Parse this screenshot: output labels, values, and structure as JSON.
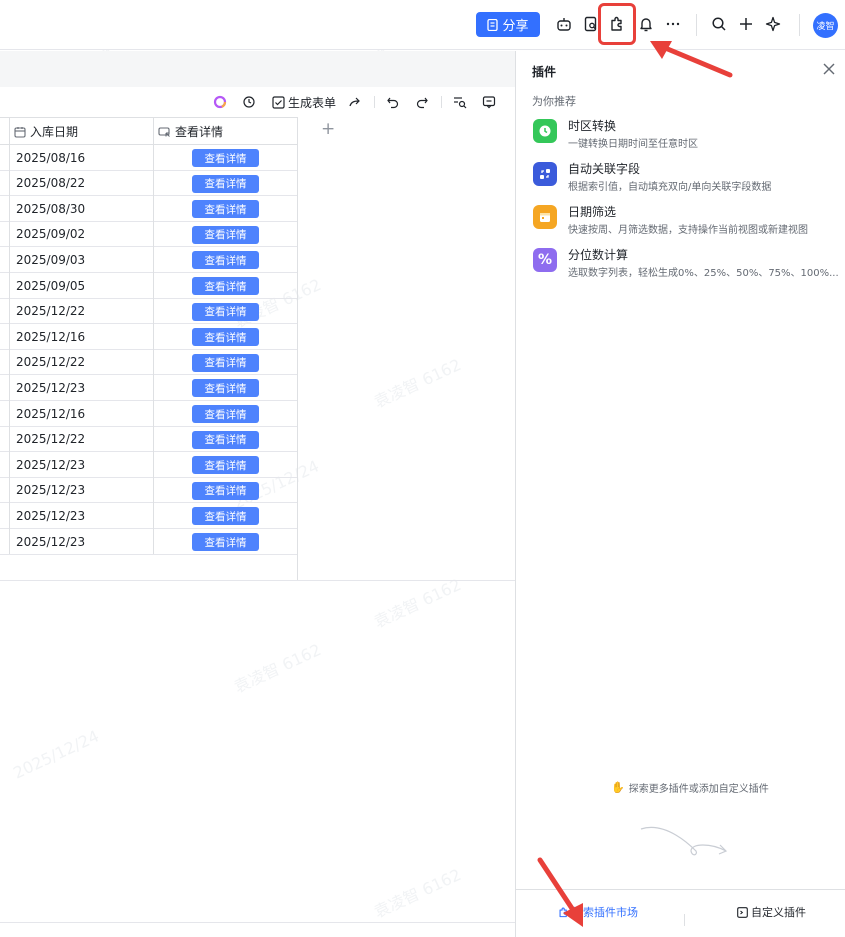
{
  "header": {
    "share_label": "分享",
    "avatar_label": "凌智"
  },
  "toolbar": {
    "generate_form_label": "生成表单"
  },
  "table": {
    "columns": [
      {
        "label": "入库日期",
        "icon": "calendar-icon"
      },
      {
        "label": "查看详情",
        "icon": "button-field-icon"
      }
    ],
    "add_column_label": "+",
    "rows": [
      {
        "date": "2025/08/16",
        "button": "查看详情"
      },
      {
        "date": "2025/08/22",
        "button": "查看详情"
      },
      {
        "date": "2025/08/30",
        "button": "查看详情"
      },
      {
        "date": "2025/09/02",
        "button": "查看详情"
      },
      {
        "date": "2025/09/03",
        "button": "查看详情"
      },
      {
        "date": "2025/09/05",
        "button": "查看详情"
      },
      {
        "date": "2025/12/22",
        "button": "查看详情"
      },
      {
        "date": "2025/12/16",
        "button": "查看详情"
      },
      {
        "date": "2025/12/22",
        "button": "查看详情"
      },
      {
        "date": "2025/12/23",
        "button": "查看详情"
      },
      {
        "date": "2025/12/16",
        "button": "查看详情"
      },
      {
        "date": "2025/12/22",
        "button": "查看详情"
      },
      {
        "date": "2025/12/23",
        "button": "查看详情"
      },
      {
        "date": "2025/12/23",
        "button": "查看详情"
      },
      {
        "date": "2025/12/23",
        "button": "查看详情"
      },
      {
        "date": "2025/12/23",
        "button": "查看详情"
      }
    ]
  },
  "panel": {
    "title": "插件",
    "recommend_label": "为你推荐",
    "plugins": [
      {
        "name": "时区转换",
        "desc": "一键转换日期时间至任意时区",
        "color": "#34c759",
        "icon": "clock-icon"
      },
      {
        "name": "自动关联字段",
        "desc": "根据索引值，自动填充双向/单向关联字段数据",
        "color": "#3b5bdb",
        "icon": "link-field-icon"
      },
      {
        "name": "日期筛选",
        "desc": "快速按周、月筛选数据，支持操作当前视图或新建视图",
        "color": "#f5a623",
        "icon": "calendar-icon"
      },
      {
        "name": "分位数计算",
        "desc": "选取数字列表，轻松生成0%、25%、50%、75%、100%...",
        "color": "#8e6cef",
        "icon": "percent-icon"
      }
    ],
    "explore_tip": "探索更多插件或添加自定义插件",
    "footer": {
      "market_label": "探索插件市场",
      "custom_label": "自定义插件"
    }
  },
  "watermark": {
    "name": "袁凌智 6162",
    "date": "2025/12/24"
  },
  "colors": {
    "accent": "#3370ff",
    "button": "#4e83fd",
    "highlight": "#e8403a"
  }
}
